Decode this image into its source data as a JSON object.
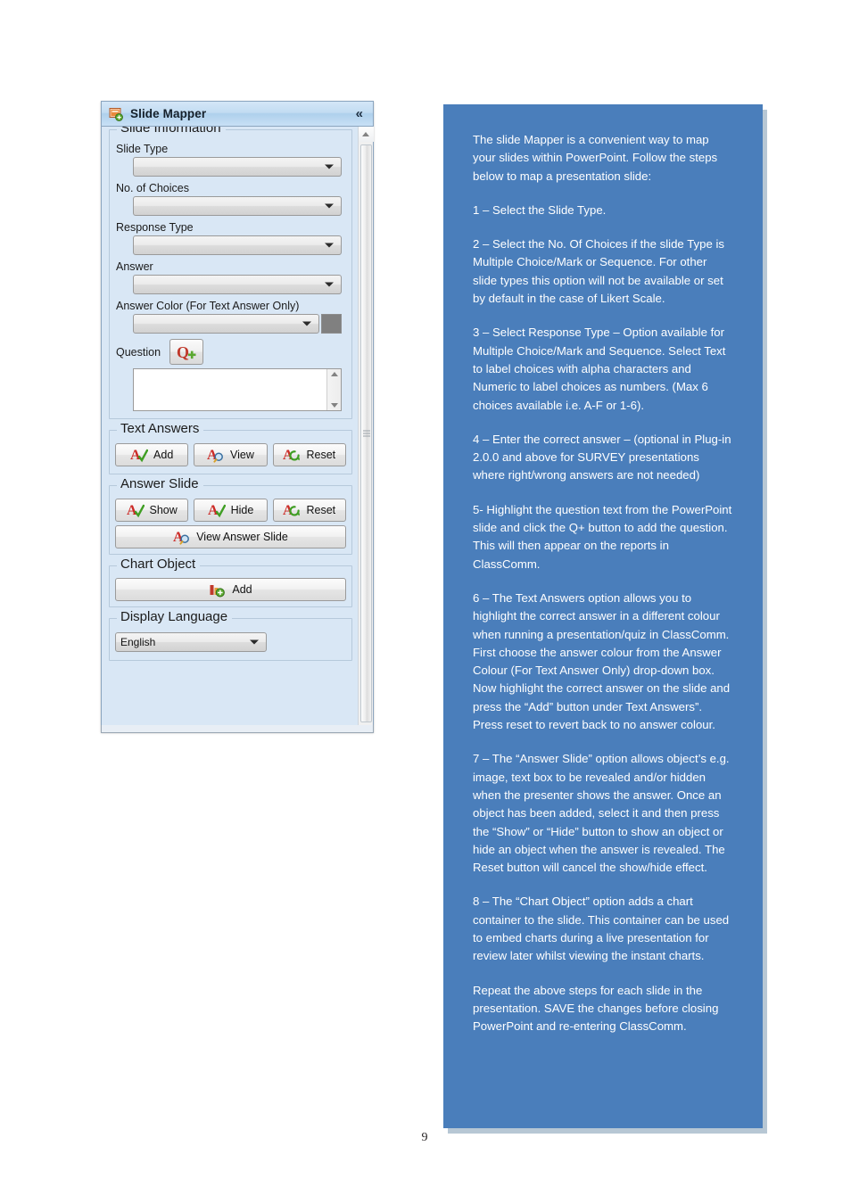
{
  "page": {
    "number": "9"
  },
  "mapper": {
    "title": "Slide Mapper",
    "title_icon": "slide-add-icon",
    "collapse_icon": "«",
    "groups": {
      "slide_information": {
        "title": "Slide Information",
        "fields": [
          {
            "label": "Slide Type",
            "value": ""
          },
          {
            "label": "No. of Choices",
            "value": ""
          },
          {
            "label": "Response Type",
            "value": ""
          },
          {
            "label": "Answer",
            "value": ""
          },
          {
            "label": "Answer Color (For Text Answer Only)",
            "value": ""
          }
        ],
        "question_label": "Question",
        "question_button_icon": "q-plus-icon",
        "question_text": ""
      },
      "text_answers": {
        "title": "Text Answers",
        "buttons": [
          {
            "label": "Add",
            "icon": "a-check-icon"
          },
          {
            "label": "View",
            "icon": "a-magnifier-icon"
          },
          {
            "label": "Reset",
            "icon": "a-refresh-icon"
          }
        ]
      },
      "answer_slide": {
        "title": "Answer Slide",
        "buttons": [
          {
            "label": "Show",
            "icon": "a-check-icon"
          },
          {
            "label": "Hide",
            "icon": "a-check-icon"
          },
          {
            "label": "Reset",
            "icon": "a-refresh-icon"
          }
        ],
        "view_button": {
          "label": "View Answer Slide",
          "icon": "a-magnifier-icon"
        }
      },
      "chart_object": {
        "title": "Chart Object",
        "add_button": {
          "label": "Add",
          "icon": "chart-add-icon"
        }
      },
      "display_language": {
        "title": "Display Language",
        "value": "English"
      }
    },
    "colors": {
      "panel_background": "#d9e7f5",
      "titlebar": "#c2dcf2",
      "color_swatch": "#808080"
    }
  },
  "info_panel": {
    "background_color": "#4a7ebb",
    "paragraphs": [
      "The slide Mapper is a convenient way to map your slides within PowerPoint.  Follow the steps below to map a presentation slide:",
      "1 – Select the Slide Type.",
      "2 – Select the No. Of Choices if the slide Type is Multiple Choice/Mark or Sequence.  For other slide types this option will not be available or set by default in the case of Likert Scale.",
      "3 – Select Response Type – Option available for Multiple Choice/Mark and Sequence.  Select Text to label choices with alpha characters and Numeric to label choices as numbers. (Max 6 choices available i.e. A-F or 1-6).",
      "4 – Enter the correct answer – (optional in Plug-in 2.0.0 and above for SURVEY presentations where right/wrong answers are not needed)",
      "5- Highlight the question text from the PowerPoint slide and click the Q+ button to add the question. This will then appear on the reports in ClassComm.",
      "6 – The Text Answers option allows you to highlight the correct answer in a different colour when running a presentation/quiz in ClassComm. First choose the answer colour from the Answer Colour (For Text Answer Only) drop-down box. Now highlight the correct answer on the slide and press the “Add” button under Text Answers”. Press reset to revert back to no answer colour.",
      "7 – The “Answer Slide” option allows object’s e.g. image, text box to be revealed and/or hidden when the presenter shows the answer. Once an object has been added, select it and then press the “Show” or “Hide” button to show an object or hide an object when the answer is revealed.  The Reset button will cancel the show/hide effect.",
      "8 – The “Chart Object” option adds a chart container to the slide.  This container can be used to embed charts during a live presentation for review later whilst viewing the instant charts.",
      "Repeat the above steps for each slide in the presentation.   SAVE the changes before closing PowerPoint and re-entering ClassComm."
    ]
  }
}
